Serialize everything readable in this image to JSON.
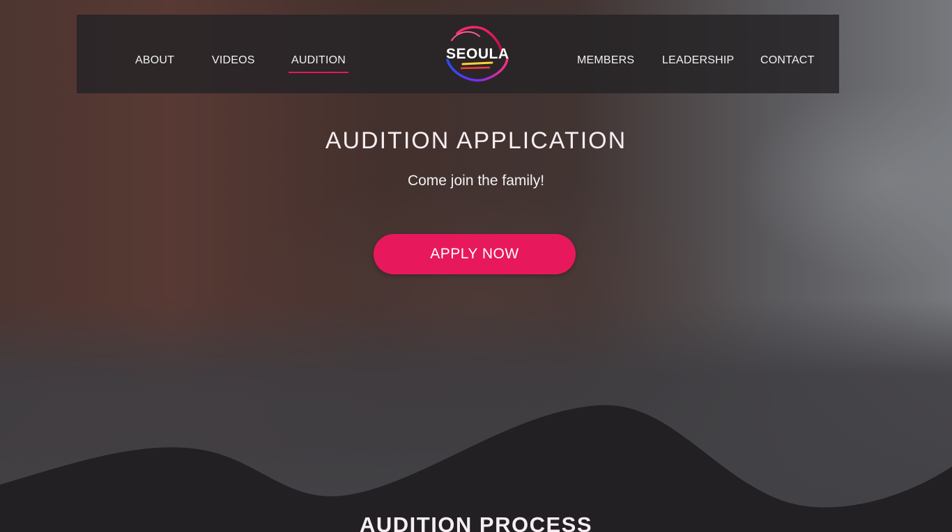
{
  "nav": {
    "left_items": [
      {
        "label": "ABOUT"
      },
      {
        "label": "VIDEOS"
      },
      {
        "label": "AUDITION",
        "active": true
      }
    ],
    "right_items": [
      {
        "label": "MEMBERS"
      },
      {
        "label": "LEADERSHIP"
      },
      {
        "label": "CONTACT"
      }
    ],
    "logo_text": "SEOULA"
  },
  "hero": {
    "title": "AUDITION APPLICATION",
    "subtitle": "Come join the family!",
    "cta_label": "APPLY NOW"
  },
  "section": {
    "title": "AUDITION PROCESS"
  },
  "colors": {
    "accent": "#e8185c",
    "nav_bg": "#262426",
    "page_bg": "#222022",
    "text": "#f2f2f2"
  }
}
